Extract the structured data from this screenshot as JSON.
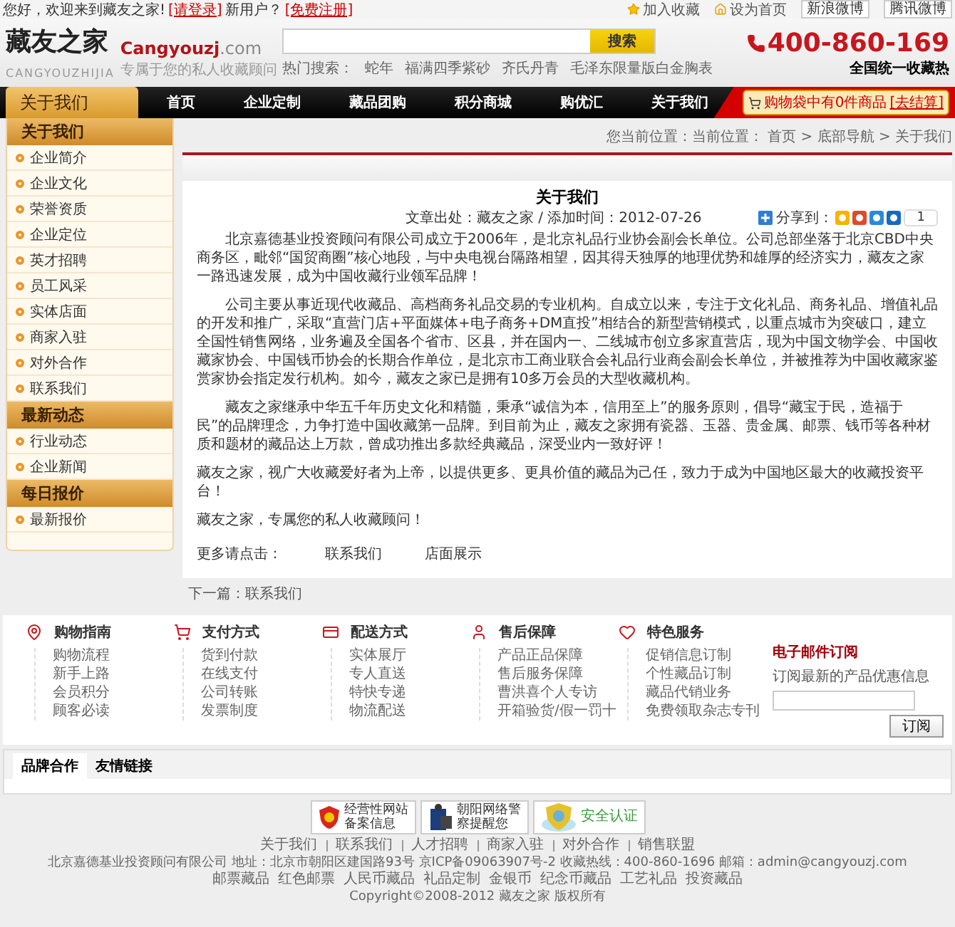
{
  "topbar": {
    "welcome": "您好，欢迎来到藏友之家!",
    "login": "[请登录]",
    "new_user": "新用户？",
    "register": "[免费注册]",
    "links": [
      "加入收藏",
      "设为首页",
      "新浪微博",
      "腾讯微博"
    ]
  },
  "logo": {
    "mark": "藏友之家",
    "domain": "Cangyouzj",
    "tld": ".com",
    "pinyin": "CANGYOUZHIJIA",
    "slogan": "专属于您的私人收藏顾问"
  },
  "search": {
    "button": "搜索",
    "hot_label": "热门搜索：",
    "hot": [
      "蛇年",
      "福满四季紫砂",
      "齐氏丹青",
      "毛泽东限量版白金胸表"
    ]
  },
  "hotline": {
    "number": "400-860-169",
    "caption": "全国统一收藏热"
  },
  "nav": {
    "section_title": "关于我们",
    "items": [
      {
        "label": "首页",
        "selected": false
      },
      {
        "label": "企业定制",
        "selected": false
      },
      {
        "label": "藏品团购",
        "selected": false
      },
      {
        "label": "积分商城",
        "selected": false
      },
      {
        "label": "购优汇",
        "selected": false
      },
      {
        "label": "关于我们",
        "selected": false
      }
    ],
    "cart": "购物袋中有0件商品",
    "checkout": "[去结算]"
  },
  "sidebar": [
    {
      "title": "关于我们",
      "items": [
        "企业简介",
        "企业文化",
        "荣誉资质",
        "企业定位",
        "英才招聘",
        "员工风采",
        "实体店面",
        "商家入驻",
        "对外合作",
        "联系我们"
      ]
    },
    {
      "title": "最新动态",
      "items": [
        "行业动态",
        "企业新闻"
      ]
    },
    {
      "title": "每日报价",
      "items": [
        "最新报价"
      ]
    }
  ],
  "breadcrumb": "您当前位置：当前位置： 首页 > 底部导航 > 关于我们",
  "article": {
    "title": "关于我们",
    "meta": "文章出处：藏友之家 / 添加时间：2012-07-26",
    "share_label": "分享到：",
    "share_count": "1",
    "paragraphs": [
      {
        "indent": true,
        "text": "北京嘉德基业投资顾问有限公司成立于2006年，是北京礼品行业协会副会长单位。公司总部坐落于北京CBD中央商务区，毗邻“国贸商圈”核心地段，与中央电视台隔路相望，因其得天独厚的地理优势和雄厚的经济实力，藏友之家一路迅速发展，成为中国收藏行业领军品牌！"
      },
      {
        "indent": true,
        "text": "公司主要从事近现代收藏品、高档商务礼品交易的专业机构。自成立以来，专注于文化礼品、商务礼品、增值礼品的开发和推广，采取“直营门店+平面媒体+电子商务+DM直投”相结合的新型营销模式，以重点城市为突破口，建立全国性销售网络，业务遍及全国各个省市、区县，并在国内一、二线城市创立多家直营店，现为中国文物学会、中国收藏家协会、中国钱币协会的长期合作单位，是北京市工商业联合会礼品行业商会副会长单位，并被推荐为中国收藏家鉴赏家协会指定发行机构。如今，藏友之家已是拥有10多万会员的大型收藏机构。"
      },
      {
        "indent": true,
        "text": "藏友之家继承中华五千年历史文化和精髓，秉承“诚信为本，信用至上”的服务原则，倡导“藏宝于民，造福于民”的品牌理念，力争打造中国收藏第一品牌。到目前为止，藏友之家拥有瓷器、玉器、贵金属、邮票、钱币等各种材质和题材的藏品达上万款，曾成功推出多款经典藏品，深受业内一致好评！"
      },
      {
        "indent": false,
        "text": "藏友之家，视广大收藏爱好者为上帝，以提供更多、更具价值的藏品为己任，致力于成为中国地区最大的收藏投资平台！"
      },
      {
        "indent": false,
        "text": "藏友之家，专属您的私人收藏顾问！"
      }
    ],
    "more_label": "更多请点击：",
    "more_links": [
      "联系我们",
      "店面展示"
    ]
  },
  "next_article": "下一篇：联系我们",
  "services": [
    {
      "title": "购物指南",
      "items": [
        "购物流程",
        "新手上路",
        "会员积分",
        "顾客必读"
      ]
    },
    {
      "title": "支付方式",
      "items": [
        "货到付款",
        "在线支付",
        "公司转账",
        "发票制度"
      ]
    },
    {
      "title": "配送方式",
      "items": [
        "实体展厅",
        "专人直送",
        "特快专递",
        "物流配送"
      ]
    },
    {
      "title": "售后保障",
      "items": [
        "产品正品保障",
        "售后服务保障",
        "曹洪喜个人专访",
        "开箱验货/假一罚十"
      ]
    },
    {
      "title": "特色服务",
      "items": [
        "促销信息订制",
        "个性藏品订制",
        "藏品代销业务",
        "免费领取杂志专刊"
      ]
    }
  ],
  "subscribe": {
    "title": "电子邮件订阅",
    "text": "订阅最新的产品优惠信息",
    "button": "订阅"
  },
  "link_tabs": [
    {
      "label": "品牌合作",
      "selected": true
    },
    {
      "label": "友情链接",
      "selected": false
    }
  ],
  "badges": [
    {
      "lines": [
        "经营性网站",
        "备案信息"
      ]
    },
    {
      "lines": [
        "朝阳网络警",
        "察提醒您"
      ]
    },
    {
      "lines": [
        "安全认证"
      ]
    }
  ],
  "footer": {
    "links": [
      "关于我们",
      "联系我们",
      "人才招聘",
      "商家入驻",
      "对外合作",
      "销售联盟"
    ],
    "info": "北京嘉德基业投资顾问有限公司  地址：北京市朝阳区建国路93号   京ICP备09063907号-2  收藏热线：400-860-1696 邮箱：admin@cangyouzj.com",
    "categories": [
      "邮票藏品",
      "红色邮票",
      "人民币藏品",
      "礼品定制",
      "金银币",
      "纪念币藏品",
      "工艺礼品",
      "投资藏品"
    ],
    "copyright": "Copyright©2008-2012 藏友之家 版权所有"
  }
}
